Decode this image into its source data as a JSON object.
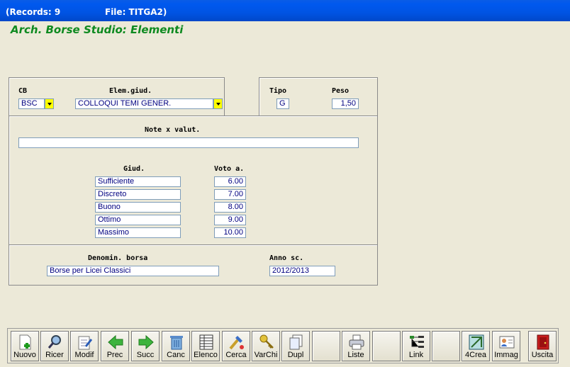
{
  "titlebar": {
    "records": "(Records: 9",
    "file": "File: TITGA2)"
  },
  "form_title": "Arch. Borse Studio: Elementi",
  "labels": {
    "cb": "CB",
    "elem_giud": "Elem.giud.",
    "tipo": "Tipo",
    "peso": "Peso",
    "note": "Note x valut.",
    "giud": "Giud.",
    "voto": "Voto a.",
    "denomin": "Denomin. borsa",
    "anno": "Anno sc."
  },
  "fields": {
    "cb": "BSC",
    "elem_giud": "COLLOQUI TEMI GENER.",
    "tipo": "G",
    "peso": "1,50",
    "note": "",
    "denomin": "Borse per Licei Classici",
    "anno": "2012/2013"
  },
  "grades": [
    {
      "giud": "Sufficiente",
      "voto": "6.00"
    },
    {
      "giud": "Discreto",
      "voto": "7.00"
    },
    {
      "giud": "Buono",
      "voto": "8.00"
    },
    {
      "giud": "Ottimo",
      "voto": "9.00"
    },
    {
      "giud": "Massimo",
      "voto": "10.00"
    }
  ],
  "toolbar": [
    {
      "label": "Nuovo",
      "icon": "new-doc-icon"
    },
    {
      "label": "Ricer",
      "icon": "search-icon"
    },
    {
      "label": "Modif",
      "icon": "edit-icon"
    },
    {
      "label": "Prec",
      "icon": "arrow-left-icon"
    },
    {
      "label": "Succ",
      "icon": "arrow-right-icon"
    },
    {
      "label": "Canc",
      "icon": "trash-icon"
    },
    {
      "label": "Elenco",
      "icon": "list-icon"
    },
    {
      "label": "Cerca",
      "icon": "find-icon"
    },
    {
      "label": "VarChi",
      "icon": "keys-icon"
    },
    {
      "label": "Dupl",
      "icon": "duplicate-icon"
    },
    {
      "label": "",
      "icon": ""
    },
    {
      "label": "Liste",
      "icon": "printer-icon"
    },
    {
      "label": "",
      "icon": ""
    },
    {
      "label": "Link",
      "icon": "link-tree-icon"
    },
    {
      "label": "",
      "icon": ""
    },
    {
      "label": "4Crea",
      "icon": "create-icon"
    },
    {
      "label": "Immag",
      "icon": "image-card-icon"
    },
    {
      "label": "Uscita",
      "icon": "exit-door-icon"
    }
  ]
}
